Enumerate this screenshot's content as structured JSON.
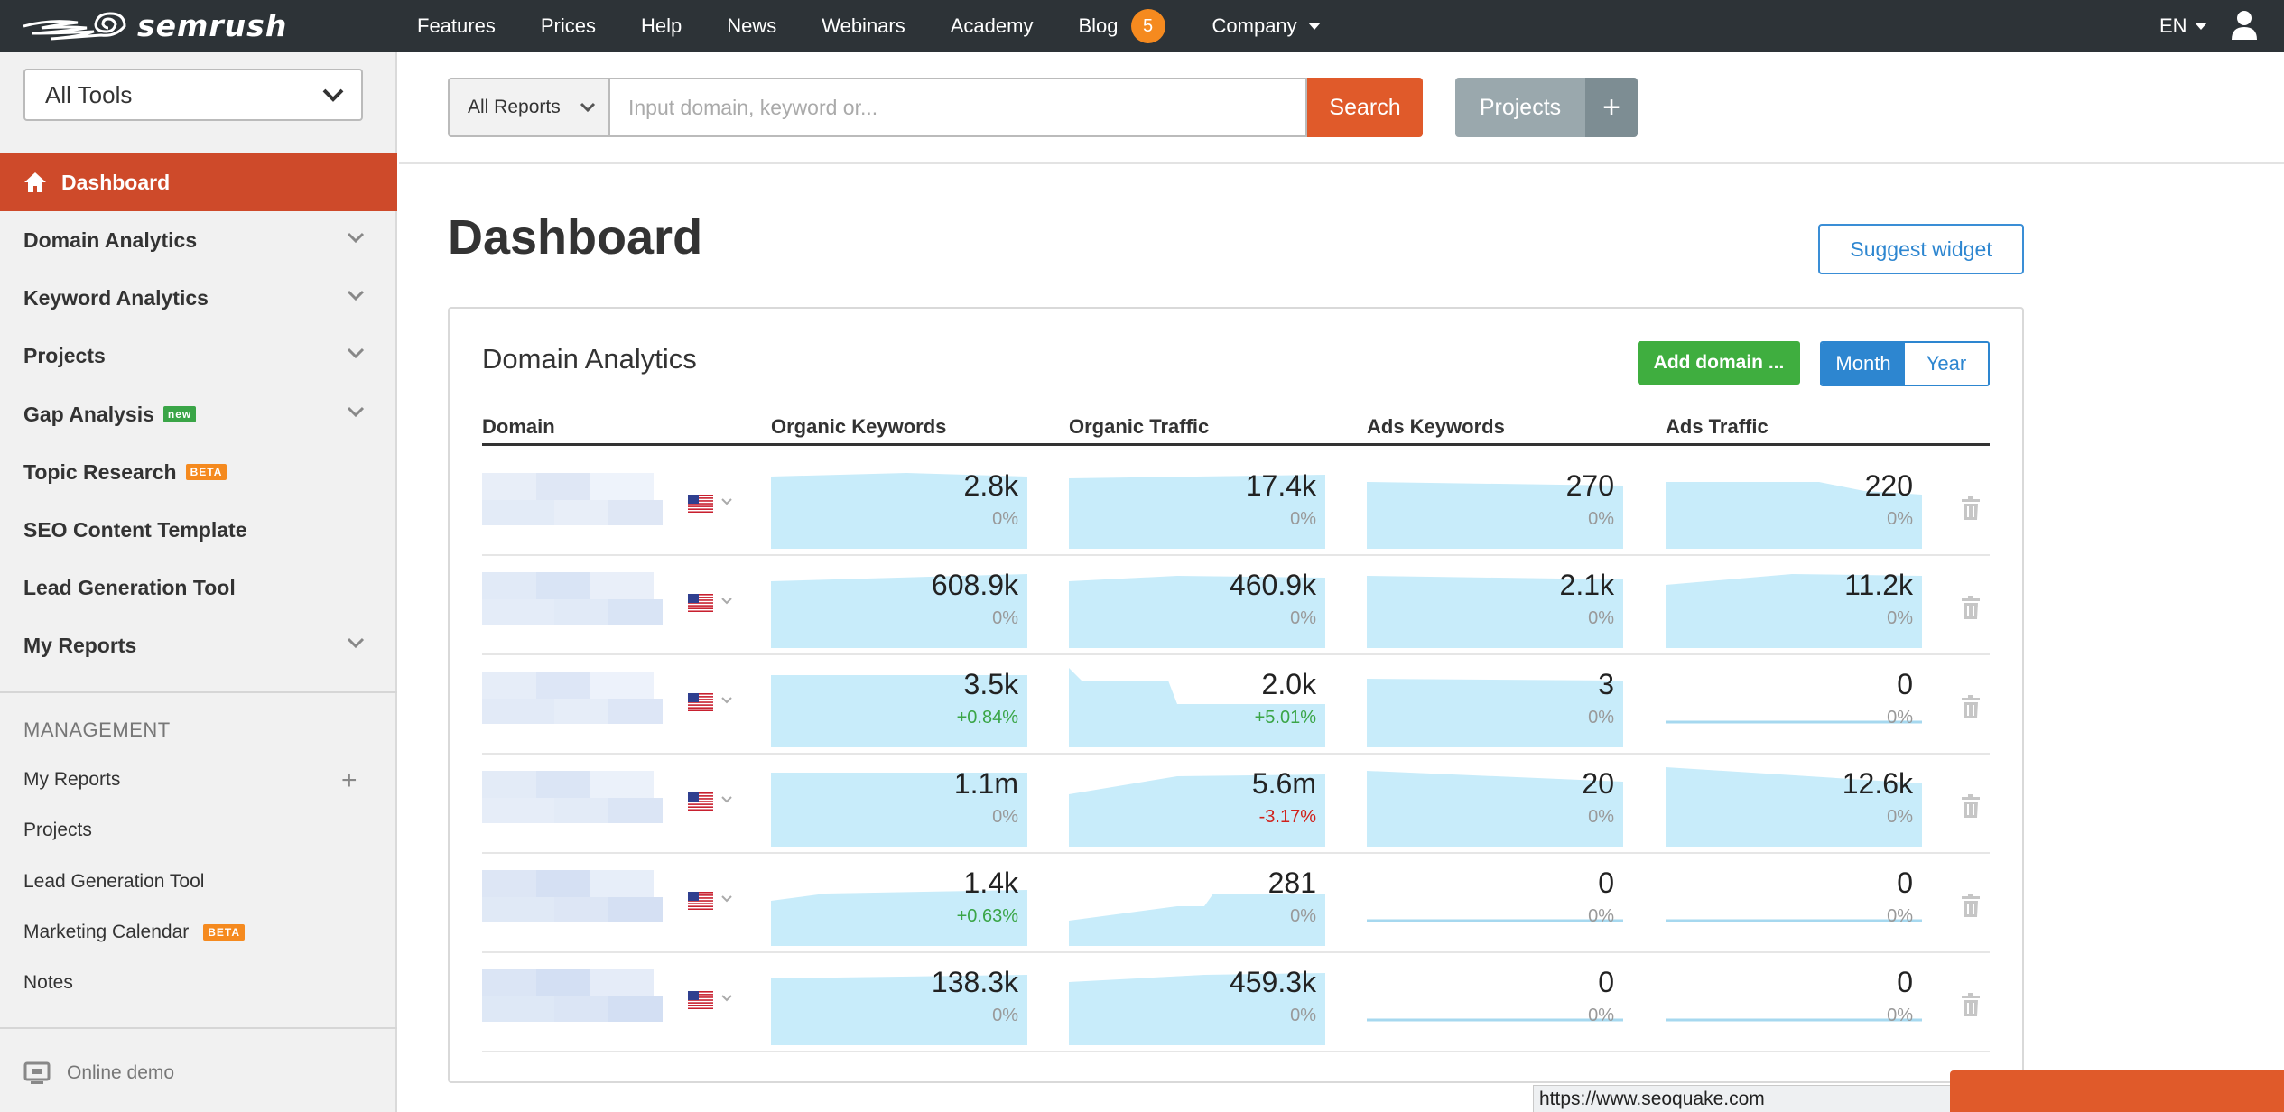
{
  "brand": {
    "name": "semrush"
  },
  "topnav": {
    "items": [
      "Features",
      "Prices",
      "Help",
      "News",
      "Webinars",
      "Academy"
    ],
    "blog_label": "Blog",
    "blog_badge": "5",
    "company_label": "Company",
    "lang": "EN"
  },
  "sidebar": {
    "tools_select": "All Tools",
    "active_item": "Dashboard",
    "items": [
      {
        "label": "Domain Analytics"
      },
      {
        "label": "Keyword Analytics"
      },
      {
        "label": "Projects"
      },
      {
        "label": "Gap Analysis",
        "tag": "new"
      },
      {
        "label": "Topic Research",
        "tag": "BETA"
      },
      {
        "label": "SEO Content Template"
      },
      {
        "label": "Lead Generation Tool"
      },
      {
        "label": "My Reports"
      }
    ],
    "management_title": "MANAGEMENT",
    "management_items": [
      {
        "label": "My Reports"
      },
      {
        "label": "Projects"
      },
      {
        "label": "Lead Generation Tool"
      },
      {
        "label": "Marketing Calendar",
        "tag": "BETA"
      },
      {
        "label": "Notes"
      }
    ],
    "online_demo": "Online demo"
  },
  "search": {
    "scope": "All Reports",
    "placeholder": "Input domain, keyword or...",
    "button": "Search",
    "projects_button": "Projects",
    "projects_plus": "+"
  },
  "page": {
    "title": "Dashboard",
    "suggest_widget": "Suggest widget"
  },
  "widget": {
    "title": "Domain Analytics",
    "add_domain": "Add domain ...",
    "period_month": "Month",
    "period_year": "Year",
    "columns": [
      "Domain",
      "Organic Keywords",
      "Organic Traffic",
      "Ads Keywords",
      "Ads Traffic"
    ],
    "rows": [
      {
        "ok": "2.8k",
        "ok_pct": "0%",
        "ot": "17.4k",
        "ot_pct": "0%",
        "ak": "270",
        "ak_pct": "0%",
        "at": "220",
        "at_pct": "0%"
      },
      {
        "ok": "608.9k",
        "ok_pct": "0%",
        "ot": "460.9k",
        "ot_pct": "0%",
        "ak": "2.1k",
        "ak_pct": "0%",
        "at": "11.2k",
        "at_pct": "0%"
      },
      {
        "ok": "3.5k",
        "ok_pct": "+0.84%",
        "ot": "2.0k",
        "ot_pct": "+5.01%",
        "ak": "3",
        "ak_pct": "0%",
        "at": "0",
        "at_pct": "0%"
      },
      {
        "ok": "1.1m",
        "ok_pct": "0%",
        "ot": "5.6m",
        "ot_pct": "-3.17%",
        "ak": "20",
        "ak_pct": "0%",
        "at": "12.6k",
        "at_pct": "0%"
      },
      {
        "ok": "1.4k",
        "ok_pct": "+0.63%",
        "ot": "281",
        "ot_pct": "0%",
        "ak": "0",
        "ak_pct": "0%",
        "at": "0",
        "at_pct": "0%"
      },
      {
        "ok": "138.3k",
        "ok_pct": "0%",
        "ot": "459.3k",
        "ot_pct": "0%",
        "ak": "0",
        "ak_pct": "0%",
        "at": "0",
        "at_pct": "0%"
      }
    ]
  },
  "statusbar": {
    "url": "https://www.seoquake.com"
  },
  "colors": {
    "topbar": "#2d3337",
    "accent_orange": "#e05a2a",
    "active_sidebar": "#ce4a2a",
    "green": "#3fae3f",
    "blue": "#2d86d0",
    "chart_fill": "#c8ecfa",
    "chart_stroke": "#a6d8ef"
  }
}
